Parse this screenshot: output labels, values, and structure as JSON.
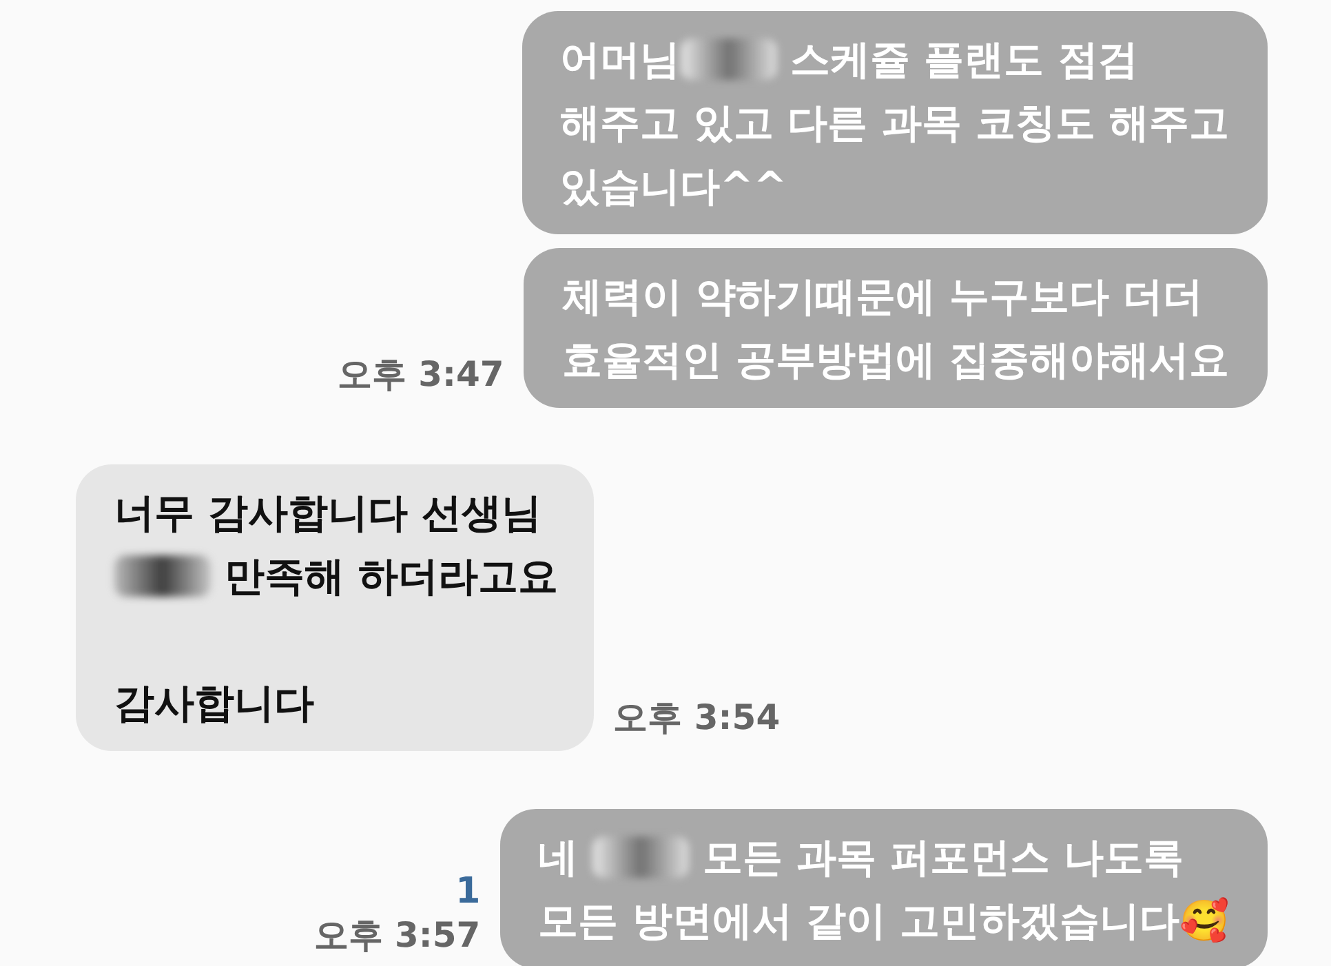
{
  "messages": [
    {
      "kind": "outgoing",
      "lines": [
        [
          {
            "kind": "text",
            "text": "어머님"
          },
          {
            "kind": "blur"
          },
          {
            "kind": "text",
            "text": " 스케쥴 플랜도 점검"
          }
        ],
        [
          {
            "kind": "text",
            "text": "해주고 있고 다른 과목 코칭도 해주고"
          }
        ],
        [
          {
            "kind": "text",
            "text": "있습니다^^"
          }
        ]
      ]
    },
    {
      "kind": "outgoing",
      "time": "오후 3:47",
      "lines": [
        [
          {
            "kind": "text",
            "text": "체력이 약하기때문에 누구보다 더더"
          }
        ],
        [
          {
            "kind": "text",
            "text": "효율적인 공부방법에 집중해야해서요"
          }
        ]
      ]
    },
    {
      "kind": "incoming",
      "time": "오후 3:54",
      "lines": [
        [
          {
            "kind": "text",
            "text": "너무 감사합니다 선생님"
          }
        ],
        [
          {
            "kind": "blur"
          },
          {
            "kind": "text",
            "text": " 만족해 하더라고요"
          }
        ],
        [
          {
            "kind": "gap"
          }
        ],
        [
          {
            "kind": "text",
            "text": "감사합니다"
          }
        ]
      ]
    },
    {
      "kind": "outgoing",
      "unread": "1",
      "time": "오후 3:57",
      "lines": [
        [
          {
            "kind": "text",
            "text": "네 "
          },
          {
            "kind": "blur"
          },
          {
            "kind": "text",
            "text": " 모든 과목 퍼포먼스 나도록"
          }
        ],
        [
          {
            "kind": "text",
            "text": "모든 방면에서 같이 고민하겠습니다🥰"
          }
        ]
      ]
    }
  ]
}
